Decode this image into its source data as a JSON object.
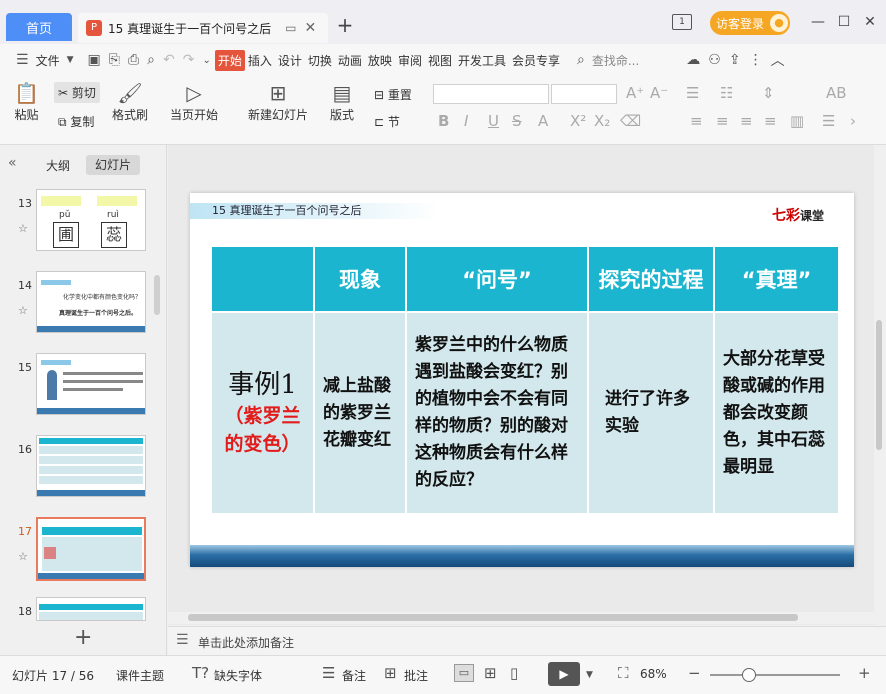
{
  "titlebar": {
    "home_tab": "首页",
    "doc_tab": "15 真理诞生于一百个问号之后",
    "add_tab": "+",
    "login": "访客登录",
    "page_badge": "1"
  },
  "menu": {
    "file": "文件",
    "tabs": [
      "开始",
      "插入",
      "设计",
      "切换",
      "动画",
      "放映",
      "审阅",
      "视图",
      "开发工具",
      "会员专享"
    ],
    "search_placeholder": "查找命..."
  },
  "ribbon": {
    "paste": "粘贴",
    "cut": "剪切",
    "copy": "复制",
    "format_painter": "格式刷",
    "from_current": "当页开始",
    "new_slide": "新建幻灯片",
    "layout": "版式",
    "reset": "重置",
    "section": "节"
  },
  "left_panel": {
    "tab_outline": "大纲",
    "tab_slides": "幻灯片",
    "slides": [
      {
        "num": "13",
        "star": "☆",
        "selected": false
      },
      {
        "num": "14",
        "star": "☆",
        "selected": false
      },
      {
        "num": "15",
        "star": "",
        "selected": false
      },
      {
        "num": "16",
        "star": "",
        "selected": false
      },
      {
        "num": "17",
        "star": "☆",
        "selected": true
      },
      {
        "num": "18",
        "star": "",
        "selected": false
      }
    ],
    "thumb13": {
      "pu": "pǔ",
      "rui": "ruì"
    },
    "thumb14": {
      "q": "化学变化中都有颜色变化吗？",
      "a": "真理诞生于一百个问号之后。"
    }
  },
  "slide": {
    "header": "15   真理诞生于一百个问号之后",
    "logo_main": "七彩",
    "logo_sub": "课堂",
    "table": {
      "headers": [
        "",
        "现象",
        "“问号”",
        "探究的过程",
        "“真理”"
      ],
      "case_main": "事例1",
      "case_sub": "（紫罗兰的变色）",
      "phenomenon": "减上盐酸的紫罗兰花瓣变红",
      "question": "紫罗兰中的什么物质遇到盐酸会变红？别的植物中会不会有同样的物质？别的酸对这种物质会有什么样的反应？",
      "process": "进行了许多实验",
      "truth": "大部分花草受酸或碱的作用都会改变颜色，其中石蕊最明显"
    }
  },
  "notes": {
    "placeholder": "单击此处添加备注"
  },
  "status": {
    "slide_counter": "幻灯片 17 / 56",
    "theme": "课件主题",
    "missing_font": "缺失字体",
    "notes": "备注",
    "comment": "批注",
    "zoom": "68%",
    "zoom_level": 0.29
  }
}
